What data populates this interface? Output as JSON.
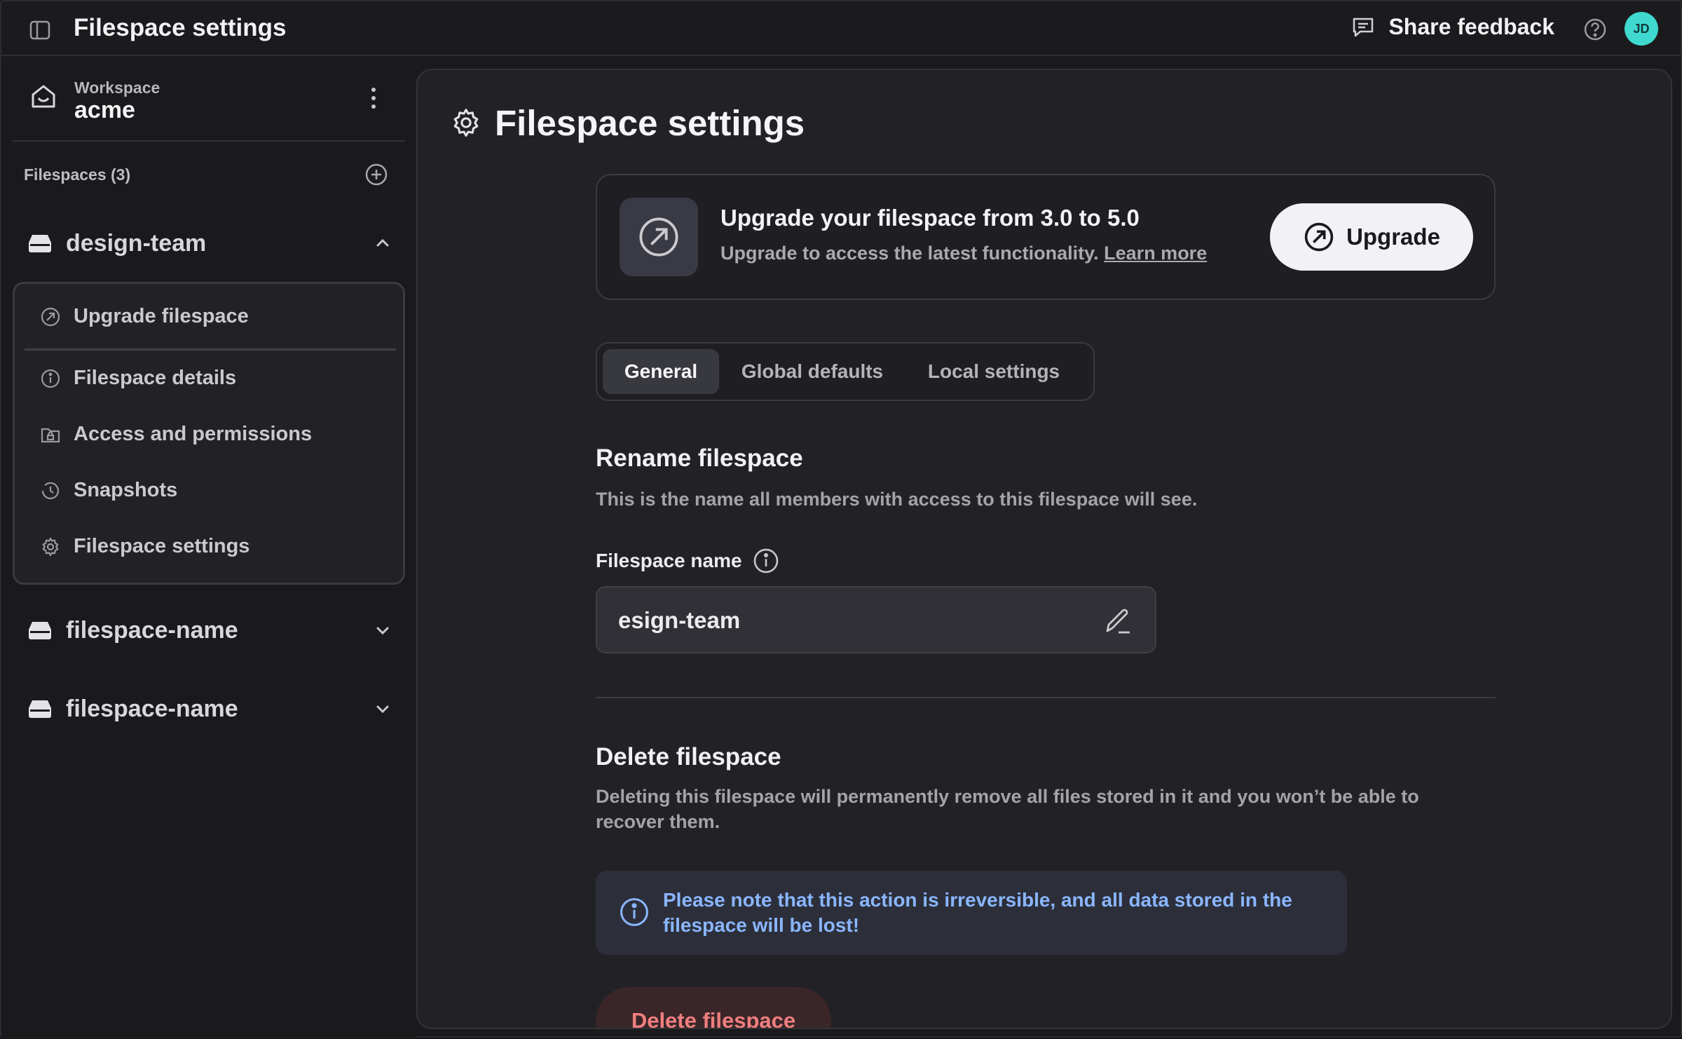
{
  "topbar": {
    "title": "Filespace settings",
    "feedback_label": "Share feedback",
    "avatar_initials": "JD"
  },
  "sidebar": {
    "workspace_label": "Workspace",
    "workspace_name": "acme",
    "filespaces_count_label": "Filespaces (3)",
    "groups": [
      {
        "name": "design-team",
        "expanded": true
      },
      {
        "name": "filespace-name",
        "expanded": false
      },
      {
        "name": "filespace-name",
        "expanded": false
      }
    ],
    "submenu": [
      {
        "label": "Upgrade filespace",
        "icon": "upgrade-icon"
      },
      {
        "label": "Filespace details",
        "icon": "info-icon"
      },
      {
        "label": "Access and permissions",
        "icon": "lock-folder-icon"
      },
      {
        "label": "Snapshots",
        "icon": "history-icon"
      },
      {
        "label": "Filespace settings",
        "icon": "gear-icon"
      }
    ]
  },
  "main": {
    "page_title": "Filespace settings",
    "upgrade": {
      "title": "Upgrade your filespace from 3.0 to 5.0",
      "description": "Upgrade to access the latest functionality.",
      "learn_more": "Learn more",
      "button_label": "Upgrade"
    },
    "tabs": [
      {
        "label": "General",
        "active": true
      },
      {
        "label": "Global defaults",
        "active": false
      },
      {
        "label": "Local settings",
        "active": false
      }
    ],
    "rename": {
      "title": "Rename filespace",
      "description": "This is the name all members with access to this filespace will see.",
      "field_label": "Filespace name",
      "field_value": "esign-team"
    },
    "delete": {
      "title": "Delete filespace",
      "description": "Deleting this filespace will permanently remove all files stored in it and you won’t be able to recover them.",
      "notice": "Please note that this action is irreversible, and all data stored in the filespace will be lost!",
      "button_label": "Delete filespace"
    }
  },
  "colors": {
    "background": "#1a1a1d",
    "panel": "#222226",
    "accent_info": "#8ab6ff",
    "danger": "#f07f7f",
    "avatar": "#3fd9cf"
  }
}
